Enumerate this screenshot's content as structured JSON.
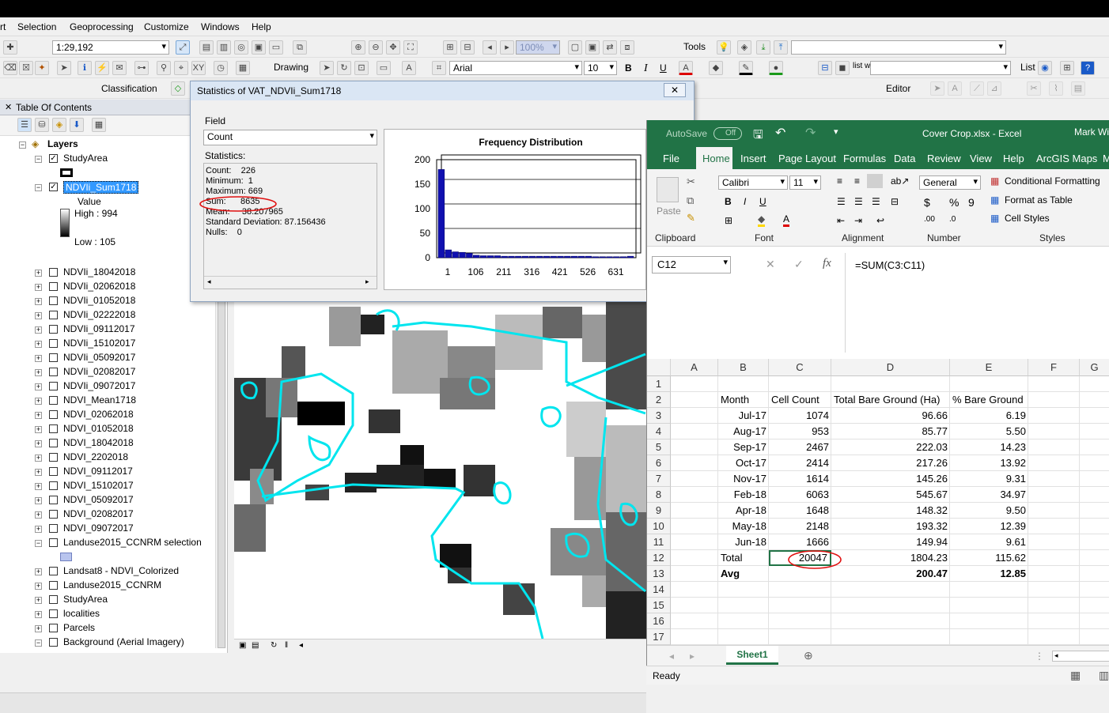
{
  "menu": {
    "items": [
      "rt",
      "Selection",
      "Geoprocessing",
      "Customize",
      "Windows",
      "Help"
    ]
  },
  "toolbar": {
    "scale": "1:29,192",
    "drawing_label": "Drawing",
    "font_name": "Arial",
    "font_size": "10",
    "bold": "B",
    "italic": "I",
    "underline": "U",
    "tools_label": "Tools",
    "classification_label": "Classification",
    "editor_label": "Editor",
    "zoom_field": "100%"
  },
  "toc": {
    "title": "Table Of Contents",
    "root": "Layers",
    "study_area": "StudyArea",
    "active_layer": "NDVIi_Sum1718",
    "legend_value": "Value",
    "legend_high": "High : 994",
    "legend_low": "Low : 105",
    "layers": [
      "NDVIi_18042018",
      "NDVIi_02062018",
      "NDVIi_01052018",
      "NDVIi_02222018",
      "NDVIi_09112017",
      "NDVIi_15102017",
      "NDVIi_05092017",
      "NDVIi_02082017",
      "NDVIi_09072017",
      "NDVI_Mean1718",
      "NDVI_02062018",
      "NDVI_01052018",
      "NDVI_18042018",
      "NDVI_2202018",
      "NDVI_09112017",
      "NDVI_15102017",
      "NDVI_05092017",
      "NDVI_02082017",
      "NDVI_09072017",
      "Landuse2015_CCNRM selection"
    ],
    "layers_lower": [
      "Landsat8 - NDVI_Colorized",
      "Landuse2015_CCNRM",
      "StudyArea",
      "localities",
      "Parcels",
      "Background (Aerial Imagery)"
    ]
  },
  "stats_dialog": {
    "title": "Statistics of VAT_NDVIi_Sum1718",
    "field_label": "Field",
    "field_value": "Count",
    "statistics_label": "Statistics:",
    "lines": [
      "Count:    226",
      "Minimum:  1",
      "Maximum: 669",
      "Sum:      8635",
      "Mean:     38.207965",
      "Standard Deviation: 87.156436",
      "Nulls:    0"
    ],
    "close": "☒"
  },
  "chart_data": {
    "type": "bar",
    "title": "Frequency Distribution",
    "x_ticks": [
      "1",
      "106",
      "211",
      "316",
      "421",
      "526",
      "631"
    ],
    "y_ticks": [
      "0",
      "50",
      "100",
      "150",
      "200"
    ],
    "ylim": [
      0,
      200
    ],
    "values": [
      180,
      16,
      12,
      11,
      9,
      5,
      4,
      4,
      4,
      3,
      3,
      3,
      3,
      3,
      3,
      3,
      3,
      3,
      3,
      3,
      3,
      3,
      2,
      2,
      2,
      2,
      2,
      3
    ],
    "bar_color": "#1010b0"
  },
  "excel": {
    "autosave_label": "AutoSave",
    "autosave_state": "Off",
    "doc_title": "Cover Crop.xlsx  -  Excel",
    "user": "Mark Wi",
    "tabs": [
      "File",
      "Home",
      "Insert",
      "Page Layout",
      "Formulas",
      "Data",
      "Review",
      "View",
      "Help",
      "ArcGIS Maps",
      "M"
    ],
    "ribbon": {
      "paste": "Paste",
      "font_name": "Calibri",
      "font_size": "11",
      "number_format": "General",
      "cond_format": "Conditional Formatting",
      "format_table": "Format as Table",
      "cell_styles": "Cell Styles",
      "groups": [
        "Clipboard",
        "Font",
        "Alignment",
        "Number",
        "Styles"
      ]
    },
    "name_box": "C12",
    "formula": "=SUM(C3:C11)",
    "columns": [
      "A",
      "B",
      "C",
      "D",
      "E",
      "F",
      "G"
    ],
    "rows": [
      "1",
      "2",
      "3",
      "4",
      "5",
      "6",
      "7",
      "8",
      "9",
      "10",
      "11",
      "12",
      "13",
      "14",
      "15",
      "16",
      "17"
    ],
    "headers": {
      "b": "Month",
      "c": "Cell Count",
      "d": "Total Bare Ground (Ha)",
      "e": "% Bare Ground"
    },
    "data": [
      {
        "b": "Jul-17",
        "c": "1074",
        "d": "96.66",
        "e": "6.19"
      },
      {
        "b": "Aug-17",
        "c": "953",
        "d": "85.77",
        "e": "5.50"
      },
      {
        "b": "Sep-17",
        "c": "2467",
        "d": "222.03",
        "e": "14.23"
      },
      {
        "b": "Oct-17",
        "c": "2414",
        "d": "217.26",
        "e": "13.92"
      },
      {
        "b": "Nov-17",
        "c": "1614",
        "d": "145.26",
        "e": "9.31"
      },
      {
        "b": "Feb-18",
        "c": "6063",
        "d": "545.67",
        "e": "34.97"
      },
      {
        "b": "Apr-18",
        "c": "1648",
        "d": "148.32",
        "e": "9.50"
      },
      {
        "b": "May-18",
        "c": "2148",
        "d": "193.32",
        "e": "12.39"
      },
      {
        "b": "Jun-18",
        "c": "1666",
        "d": "149.94",
        "e": "9.61"
      }
    ],
    "total": {
      "b": "Total",
      "c": "20047",
      "d": "1804.23",
      "e": "115.62"
    },
    "avg": {
      "b": "Avg",
      "d": "200.47",
      "e": "12.85"
    },
    "sheet_tab": "Sheet1",
    "status": "Ready"
  },
  "colors": {
    "excel_green": "#217346",
    "polygon_cyan": "#00e5ee",
    "annotation_red": "#e01010",
    "selection_blue": "#3399ff"
  }
}
